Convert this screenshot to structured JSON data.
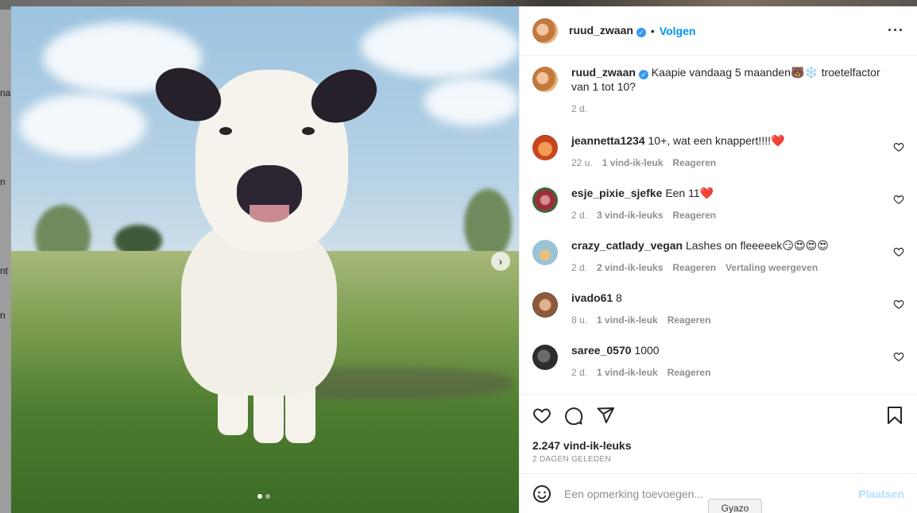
{
  "background_side_text": [
    "na",
    "n",
    "nt",
    "n"
  ],
  "post": {
    "slide_dots": 2,
    "active_slide": 0
  },
  "header": {
    "username": "ruud_zwaan",
    "verified_icon": "verified-badge-icon",
    "separator": "•",
    "follow_label": "Volgen",
    "more_icon": "more-options-icon"
  },
  "caption": {
    "username": "ruud_zwaan",
    "text": "Kaapie vandaag 5 maanden🐻❄️ troetelfactor van 1 tot 10?",
    "time": "2 d."
  },
  "comments": [
    {
      "username": "jeannetta1234",
      "text": "10+, wat een knappert!!!!❤️",
      "time": "22 u.",
      "likes": "1 vind-ik-leuk",
      "reply": "Reageren",
      "translate": ""
    },
    {
      "username": "esje_pixie_sjefke",
      "text": "Een 11❤️",
      "time": "2 d.",
      "likes": "3 vind-ik-leuks",
      "reply": "Reageren",
      "translate": ""
    },
    {
      "username": "crazy_catlady_vegan",
      "text": "Lashes on fleeeeek😏😍😍😍",
      "time": "2 d.",
      "likes": "2 vind-ik-leuks",
      "reply": "Reageren",
      "translate": "Vertaling weergeven"
    },
    {
      "username": "ivado61",
      "text": "8",
      "time": "8 u.",
      "likes": "1 vind-ik-leuk",
      "reply": "Reageren",
      "translate": ""
    },
    {
      "username": "saree_0570",
      "text": "1000",
      "time": "2 d.",
      "likes": "1 vind-ik-leuk",
      "reply": "Reageren",
      "translate": ""
    }
  ],
  "actions": {
    "likes_total": "2.247 vind-ik-leuks",
    "posted": "2 DAGEN GELEDEN"
  },
  "add_comment": {
    "placeholder": "Een opmerking toevoegen...",
    "post_label": "Plaatsen"
  },
  "tooltip": "Gyazo"
}
